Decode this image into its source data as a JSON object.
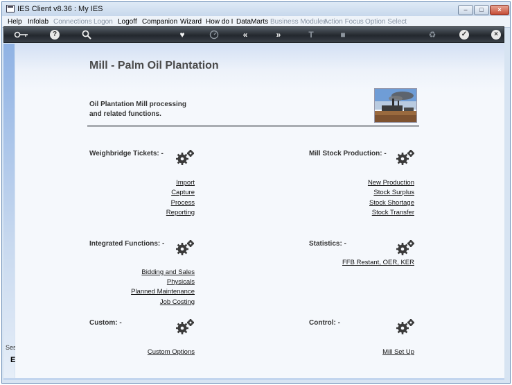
{
  "window": {
    "title": "IES Client v8.36 : My IES"
  },
  "menu": [
    {
      "label": "Help",
      "enabled": true
    },
    {
      "label": "Infolab",
      "enabled": true
    },
    {
      "label": "Connections",
      "enabled": false
    },
    {
      "label": "Logon",
      "enabled": false
    },
    {
      "label": "Logoff",
      "enabled": true
    },
    {
      "label": "Companion",
      "enabled": true
    },
    {
      "label": "Wizard",
      "enabled": true
    },
    {
      "label": "How do I",
      "enabled": true
    },
    {
      "label": "DataMarts",
      "enabled": true
    },
    {
      "label": "Business Modules",
      "enabled": false
    },
    {
      "label": "Action Focus",
      "enabled": false
    },
    {
      "label": "Option Select",
      "enabled": false
    }
  ],
  "toolbar": {
    "icons": [
      "key-icon",
      "help-icon",
      "search-icon",
      "heart-icon",
      "clock-icon",
      "back-icon",
      "forward-icon",
      "text-icon",
      "stop-icon",
      "recycle-icon",
      "check-icon",
      "close-icon"
    ]
  },
  "sidebar": {
    "session_label": "Ses",
    "glyph": "E"
  },
  "page": {
    "title": "Mill - Palm Oil Plantation",
    "intro_line1": "Oil Plantation Mill processing",
    "intro_line2": "and related functions."
  },
  "sections": {
    "weighbridge": {
      "title": "Weighbridge Tickets: -",
      "links": [
        "Import",
        "Capture",
        "Process",
        "Reporting"
      ]
    },
    "mill_stock": {
      "title": "Mill Stock Production: -",
      "links": [
        "New Production",
        "Stock Surplus",
        "Stock Shortage",
        "Stock Transfer"
      ]
    },
    "integrated": {
      "title": "Integrated Functions: -",
      "links": [
        "Bidding and Sales",
        "Physicals",
        "Planned Maintenance",
        "Job Costing"
      ]
    },
    "statistics": {
      "title": "Statistics: -",
      "links": [
        "FFB Restant, OER, KER"
      ]
    },
    "custom": {
      "title": "Custom: -",
      "links": [
        "Custom Options"
      ]
    },
    "control": {
      "title": "Control: -",
      "links": [
        "Mill Set Up"
      ]
    }
  }
}
